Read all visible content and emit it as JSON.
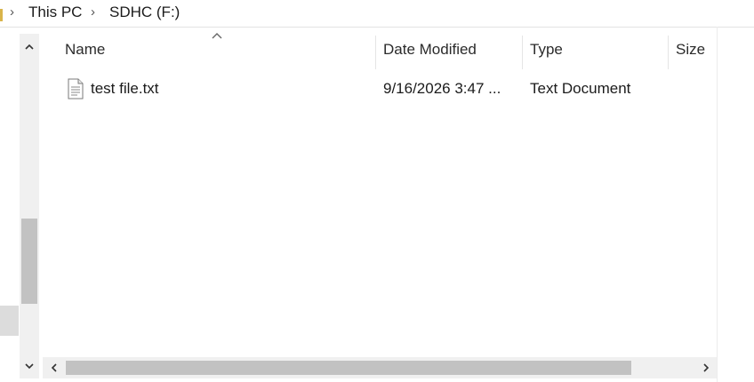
{
  "address_bar": {
    "breadcrumbs": [
      "This PC",
      "SDHC (F:)"
    ]
  },
  "nav_pane": {
    "scroll_up_icon": "chevron-up-icon",
    "scroll_down_icon": "chevron-down-icon"
  },
  "file_list": {
    "columns": [
      "Name",
      "Date Modified",
      "Type",
      "Size"
    ],
    "sorted_by": "Name",
    "sort_direction": "ascending",
    "rows": [
      {
        "name": "test file.txt",
        "date_modified": "9/16/2026 3:47 ...",
        "type": "Text Document",
        "size": "",
        "icon": "text-file-icon"
      }
    ]
  },
  "horizontal_scrollbar": {
    "left_icon": "chevron-left-icon",
    "right_icon": "chevron-right-icon"
  },
  "colors": {
    "scrollbar_track": "#f0f0f0",
    "scrollbar_thumb": "#c2c2c2",
    "text": "#1b1b1b"
  }
}
